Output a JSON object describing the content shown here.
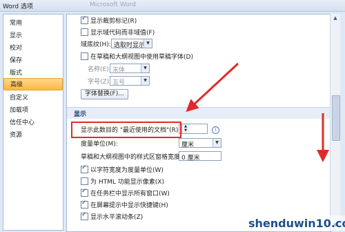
{
  "window": {
    "title": "Word 选项",
    "ghost_title": "Microsoft Word"
  },
  "sidebar": {
    "items": [
      {
        "label": "常用"
      },
      {
        "label": "显示"
      },
      {
        "label": "校对"
      },
      {
        "label": "保存"
      },
      {
        "label": "版式"
      },
      {
        "label": "高级",
        "active": true
      },
      {
        "label": "自定义"
      },
      {
        "label": "加载项"
      },
      {
        "label": "信任中心"
      },
      {
        "label": "资源"
      }
    ]
  },
  "options_top": {
    "show_crop_marks": "显示裁剪标记(R)",
    "show_field_codes": "显示域代码而非域值(F)",
    "field_shading_label": "域底纹(H):",
    "field_shading_value": "选取时显示",
    "draft_font": "在草稿和大纲视图中使用草稿字体(D)",
    "name_label": "名称(E):",
    "name_value": "宋体",
    "size_label": "字号(Z):",
    "size_value": "五号",
    "font_substitution": "字体替换(F)..."
  },
  "display_section": {
    "title": "显示",
    "recent_docs_label": "显示此数目的 \"最近使用的文档\"(R):",
    "recent_docs_value": "17",
    "measure_units_label": "度量单位(M):",
    "measure_units_value": "厘米",
    "style_area_label": "草稿和大纲视图中的样式区窗格宽度(E):",
    "style_area_value": "0 厘米",
    "char_width_units": "以字符宽度为度量单位(W)",
    "html_pixels": "为 HTML 功能显示像素(X)",
    "show_all_windows": "在任务栏中显示所有窗口(W)",
    "show_shortcut_keys": "在屏幕提示中显示快捷键(H)",
    "show_h_scroll": "显示水平滚动条(Z)"
  },
  "watermark": {
    "text": "shenduwin10.com"
  },
  "colors": {
    "accent_red": "#e0292b",
    "active_nav": "#ffc45e"
  }
}
